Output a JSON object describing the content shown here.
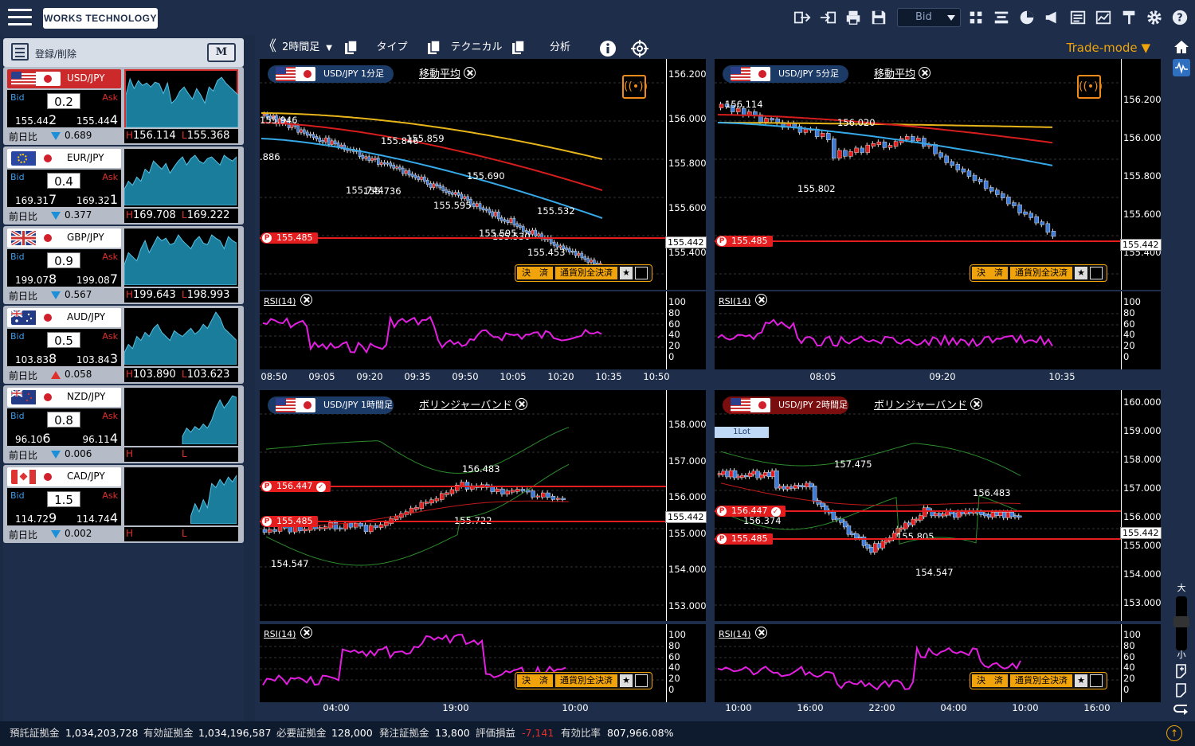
{
  "app": {
    "logo": "WORKS TECHNOLOGY"
  },
  "topbar": {
    "price_select": "Bid"
  },
  "left": {
    "register_label": "登録/削除",
    "m_button": "M",
    "pairs": [
      {
        "name": "USD/JPY",
        "selected": true,
        "flag1": "us",
        "flag2": "jp",
        "bid_label": "Bid",
        "ask_label": "Ask",
        "spread": "0.2",
        "bid_pre": "155.44",
        "bid_last": "2",
        "ask_pre": "155.44",
        "ask_last": "4",
        "change_label": "前日比",
        "dir": "down",
        "change": "0.689",
        "high": "156.114",
        "low": "155.368",
        "spark": [
          40,
          60,
          48,
          58,
          52,
          55,
          50,
          56,
          54,
          42,
          55,
          30,
          35,
          45,
          50,
          42,
          35,
          48,
          40,
          30,
          50,
          45,
          58,
          62,
          55,
          50,
          45,
          40
        ]
      },
      {
        "name": "EUR/JPY",
        "selected": false,
        "flag1": "eu",
        "flag2": "jp",
        "bid_label": "Bid",
        "ask_label": "Ask",
        "spread": "0.4",
        "bid_pre": "169.31",
        "bid_last": "7",
        "ask_pre": "169.32",
        "ask_last": "1",
        "change_label": "前日比",
        "dir": "down",
        "change": "0.377",
        "high": "169.708",
        "low": "169.222",
        "spark": [
          20,
          30,
          25,
          35,
          30,
          45,
          40,
          55,
          50,
          45,
          52,
          40,
          48,
          55,
          60,
          50,
          58,
          62,
          55,
          52,
          58,
          60,
          55,
          50,
          62,
          58,
          55,
          60
        ]
      },
      {
        "name": "GBP/JPY",
        "selected": false,
        "flag1": "gb",
        "flag2": "jp",
        "bid_label": "Bid",
        "ask_label": "Ask",
        "spread": "0.9",
        "bid_pre": "199.07",
        "bid_last": "8",
        "ask_pre": "199.08",
        "ask_last": "7",
        "change_label": "前日比",
        "dir": "down",
        "change": "0.567",
        "high": "199.643",
        "low": "198.993",
        "spark": [
          25,
          40,
          35,
          30,
          45,
          55,
          40,
          50,
          60,
          55,
          58,
          50,
          52,
          62,
          55,
          50,
          45,
          55,
          60,
          52,
          50,
          62,
          58,
          55,
          45,
          60,
          55,
          52
        ]
      },
      {
        "name": "AUD/JPY",
        "selected": false,
        "flag1": "au",
        "flag2": "jp",
        "bid_label": "Bid",
        "ask_label": "Ask",
        "spread": "0.5",
        "bid_pre": "103.83",
        "bid_last": "8",
        "ask_pre": "103.84",
        "ask_last": "3",
        "change_label": "前日比",
        "dir": "up",
        "change": "0.058",
        "high": "103.890",
        "low": "103.623",
        "spark": [
          15,
          25,
          20,
          35,
          30,
          40,
          35,
          45,
          50,
          40,
          35,
          30,
          42,
          38,
          35,
          40,
          45,
          38,
          42,
          50,
          45,
          55,
          65,
          58,
          45,
          40,
          35,
          30
        ]
      },
      {
        "name": "NZD/JPY",
        "selected": false,
        "flag1": "nz",
        "flag2": "jp",
        "bid_label": "Bid",
        "ask_label": "Ask",
        "spread": "0.8",
        "bid_pre": "96.10",
        "bid_last": "6",
        "ask_pre": "96.11",
        "ask_last": "4",
        "change_label": "前日比",
        "dir": "down",
        "change": "0.006",
        "high": "",
        "low": "",
        "spark": [
          0,
          0,
          0,
          0,
          0,
          0,
          0,
          0,
          0,
          0,
          0,
          0,
          0,
          0,
          10,
          20,
          15,
          22,
          18,
          25,
          20,
          30,
          45,
          55,
          45,
          52,
          60,
          58
        ]
      },
      {
        "name": "CAD/JPY",
        "selected": false,
        "flag1": "ca",
        "flag2": "jp",
        "bid_label": "Bid",
        "ask_label": "Ask",
        "spread": "1.5",
        "bid_pre": "114.72",
        "bid_last": "9",
        "ask_pre": "114.74",
        "ask_last": "4",
        "change_label": "前日比",
        "dir": "down",
        "change": "0.002",
        "high": "",
        "low": "",
        "spark": [
          0,
          0,
          0,
          0,
          0,
          0,
          0,
          0,
          0,
          0,
          0,
          0,
          0,
          0,
          0,
          0,
          10,
          25,
          15,
          30,
          20,
          50,
          45,
          55,
          48,
          58,
          52,
          60
        ]
      }
    ],
    "h_mark": "H",
    "l_mark": "L"
  },
  "toolbar": {
    "timeframe": "2時間足",
    "type": "タイプ",
    "technical": "テクニカル",
    "analysis": "分析",
    "trade_mode": "Trade-mode"
  },
  "charts": [
    {
      "pair": "USD/JPY 1分足",
      "indicator": "移動平均",
      "yticks": [
        "156.200",
        "156.000",
        "155.800",
        "155.600",
        "155.400"
      ],
      "current": "155.442",
      "pos_label": "155.485",
      "rsi_label": "RSI(14)",
      "rsi_ticks": [
        "100",
        "80",
        "60",
        "40",
        "20",
        "0"
      ],
      "xticks": [
        "08:50",
        "09:05",
        "09:20",
        "09:35",
        "09:50",
        "10:05",
        "10:20",
        "10:35",
        "10:50"
      ],
      "annotations": [
        "155.946",
        ".886",
        "155.846",
        "155.859",
        "155.744",
        "155.736",
        "155.690",
        "155.595",
        "155.595",
        "155.532",
        "155.530",
        "155.453"
      ],
      "settle": "決　済",
      "settle_all": "通貨別全決済"
    },
    {
      "pair": "USD/JPY 5分足",
      "indicator": "移動平均",
      "yticks": [
        "156.200",
        "156.000",
        "155.800",
        "155.600",
        "155.400"
      ],
      "current": "155.442",
      "pos_label": "155.485",
      "rsi_label": "RSI(14)",
      "rsi_ticks": [
        "100",
        "80",
        "60",
        "40",
        "20",
        "0"
      ],
      "xticks": [
        "08:05",
        "09:20",
        "10:35"
      ],
      "annotations": [
        "156.114",
        "156.020",
        "155.802"
      ],
      "settle": "決　済",
      "settle_all": "通貨別全決済"
    },
    {
      "pair": "USD/JPY 1時間足",
      "indicator": "ボリンジャーバンド",
      "yticks": [
        "158.000",
        "157.000",
        "156.000",
        "155.000",
        "154.000",
        "153.000"
      ],
      "current": "155.442",
      "pos_label": "155.485",
      "pos_label2": "156.447",
      "rsi_label": "RSI(14)",
      "rsi_ticks": [
        "100",
        "80",
        "60",
        "40",
        "20",
        "0"
      ],
      "xticks": [
        "04:00",
        "19:00",
        "10:00"
      ],
      "annotations": [
        "156.483",
        "155.722",
        "154.547"
      ],
      "settle": "決　済",
      "settle_all": "通貨別全決済"
    },
    {
      "pair": "USD/JPY 2時間足",
      "indicator": "ボリンジャーバンド",
      "yticks": [
        "160.000",
        "159.000",
        "158.000",
        "157.000",
        "156.000",
        "155.000",
        "154.000",
        "153.000"
      ],
      "current": "155.442",
      "pos_label": "155.485",
      "pos_label2": "156.447",
      "lot": "1Lot",
      "rsi_label": "RSI(14)",
      "rsi_ticks": [
        "100",
        "80",
        "60",
        "40",
        "20",
        "0"
      ],
      "xticks": [
        "10:00",
        "16:00",
        "22:00",
        "04:00",
        "10:00",
        "16:00"
      ],
      "annotations": [
        "157.475",
        "156.374",
        "155.805",
        "156.483",
        "154.547"
      ],
      "settle": "決　済",
      "settle_all": "通貨別全決済"
    }
  ],
  "right": {
    "zoom_big": "大",
    "zoom_small": "小"
  },
  "status": {
    "deposit_label": "預託証拠金",
    "deposit": "1,034,203,728",
    "effective_label": "有効証拠金",
    "effective": "1,034,196,587",
    "required_label": "必要証拠金",
    "required": "128,000",
    "order_label": "発注証拠金",
    "order": "13,800",
    "pl_label": "評価損益",
    "pl": "-7,141",
    "ratio_label": "有効比率",
    "ratio": "807,966.08%"
  }
}
